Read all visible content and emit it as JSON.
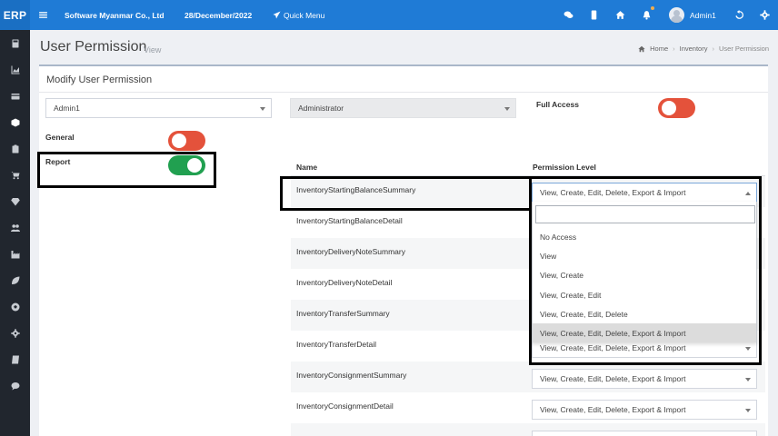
{
  "topbar": {
    "brand": "ERP",
    "company": "Software Myanmar Co., Ltd",
    "date": "28/December/2022",
    "quick_menu": "Quick Menu",
    "user": "Admin1",
    "icons": [
      "menu-icon",
      "chat-icon",
      "mobile-icon",
      "home-icon",
      "bell-icon",
      "history-icon",
      "gear-icon"
    ]
  },
  "sidebar": {
    "icons": [
      "calculator-icon",
      "chart-icon",
      "card-icon",
      "cube-icon",
      "clipboard-icon",
      "cart-icon",
      "diamond-icon",
      "users-icon",
      "factory-icon",
      "leaf-icon",
      "soccer-icon",
      "settings-icon",
      "book-icon",
      "comment-icon"
    ]
  },
  "page": {
    "title": "User Permission",
    "subtitle": "View",
    "breadcrumb": [
      "Home",
      "Inventory",
      "User Permission"
    ]
  },
  "card": {
    "title": "Modify User Permission",
    "user_select": "Admin1",
    "role_select": "Administrator",
    "full_access_label": "Full Access",
    "general_label": "General",
    "report_label": "Report",
    "toggles": {
      "full_access": false,
      "general": false,
      "report": true
    },
    "colors": {
      "toggle_on": "#21a050",
      "toggle_off": "#e4523b"
    }
  },
  "table": {
    "headers": {
      "name": "Name",
      "level": "Permission Level"
    },
    "rows": [
      {
        "name": "InventoryStartingBalanceSummary",
        "level": "View, Create, Edit, Delete, Export & Import"
      },
      {
        "name": "InventoryStartingBalanceDetail",
        "level": ""
      },
      {
        "name": "InventoryDeliveryNoteSummary",
        "level": ""
      },
      {
        "name": "InventoryDeliveryNoteDetail",
        "level": ""
      },
      {
        "name": "InventoryTransferSummary",
        "level": ""
      },
      {
        "name": "InventoryTransferDetail",
        "level": "View, Create, Edit, Delete, Export & Import"
      },
      {
        "name": "InventoryConsignmentSummary",
        "level": "View, Create, Edit, Delete, Export & Import"
      },
      {
        "name": "InventoryConsignmentDetail",
        "level": "View, Create, Edit, Delete, Export & Import"
      }
    ]
  },
  "dropdown": {
    "options": [
      "No Access",
      "View",
      "View, Create",
      "View, Create, Edit",
      "View, Create, Edit, Delete",
      "View, Create, Edit, Delete, Export & Import"
    ],
    "selected_index": 5
  }
}
